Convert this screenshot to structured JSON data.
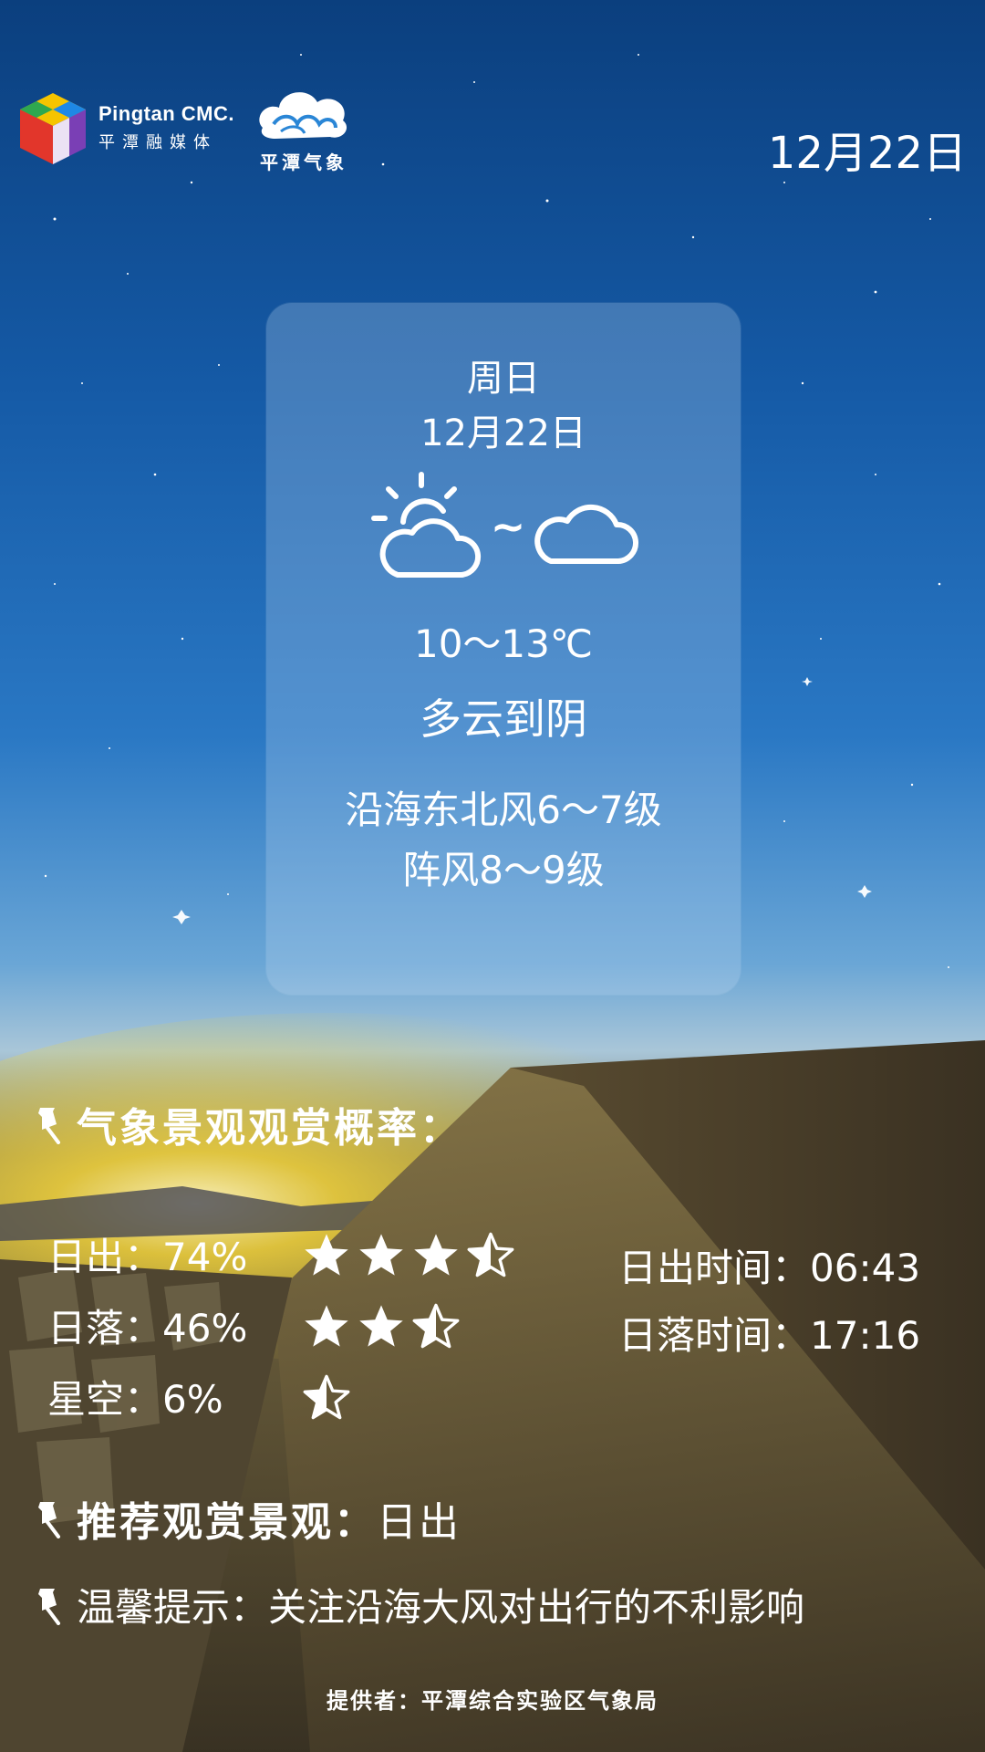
{
  "header": {
    "brand_en": "Pingtan CMC.",
    "brand_cn": "平潭融媒体",
    "weather_brand": "平潭气象",
    "date": "12月22日"
  },
  "card": {
    "weekday": "周日",
    "date": "12月22日",
    "icon_from": "partly-cloudy-icon",
    "icon_sep": "~",
    "icon_to": "cloudy-icon",
    "temperature": "10～13℃",
    "condition": "多云到阴",
    "wind_line1": "沿海东北风6～7级",
    "wind_line2": "阵风8～9级"
  },
  "probability": {
    "title": "气象景观观赏概率：",
    "items": [
      {
        "label": "日出：74%",
        "rating": 3.5
      },
      {
        "label": "日落：46%",
        "rating": 2.5
      },
      {
        "label": "星空：6%",
        "rating": 0.5
      }
    ],
    "sunrise_time": "日出时间：06:43",
    "sunset_time": "日落时间：17:16"
  },
  "recommend": {
    "title": "推荐观赏景观：",
    "value": "日出"
  },
  "tip": {
    "label": "温馨提示：",
    "text": "关注沿海大风对出行的不利影响"
  },
  "footer": "提供者：平潭综合实验区气象局",
  "colors": {
    "sky_top": "#0b3f7e",
    "horizon": "#f2d23a",
    "ground": "#2a261d"
  }
}
